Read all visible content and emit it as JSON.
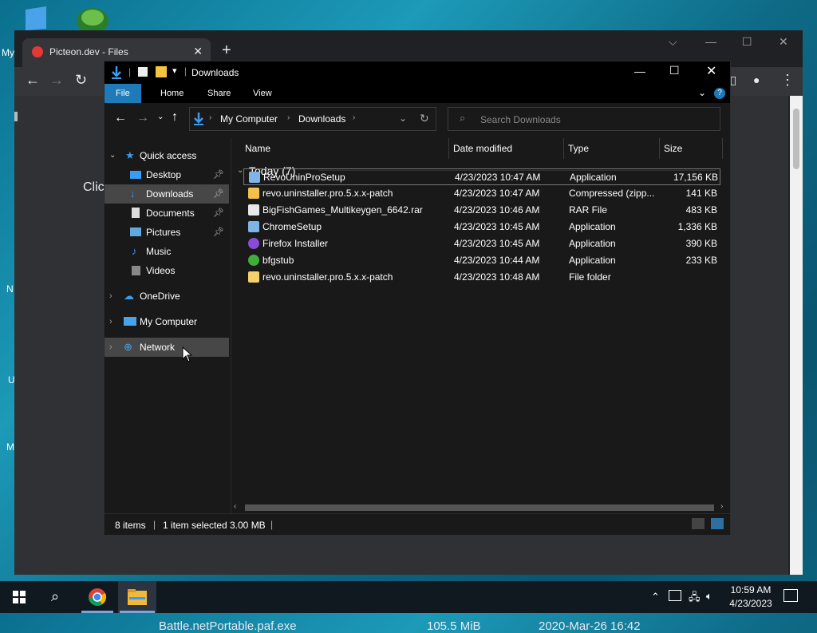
{
  "desktop": {
    "my_label": "My",
    "edge_letters": [
      "N",
      "U",
      "M"
    ]
  },
  "browser": {
    "tab_title": "Picteon.dev - Files",
    "tab_close": "✕",
    "new_tab": "+",
    "page_left_text": "Clic",
    "file_row": {
      "name": "Battle.netPortable.paf.exe",
      "size": "105.5 MiB",
      "date": "2020-Mar-26 16:42"
    }
  },
  "explorer": {
    "title": "Downloads",
    "ribbon_tabs": [
      "File",
      "Home",
      "Share",
      "View"
    ],
    "breadcrumb": [
      "My Computer",
      "Downloads"
    ],
    "search_placeholder": "Search Downloads",
    "nav": {
      "quick_access": "Quick access",
      "desktop": "Desktop",
      "downloads": "Downloads",
      "documents": "Documents",
      "pictures": "Pictures",
      "music": "Music",
      "videos": "Videos",
      "onedrive": "OneDrive",
      "my_computer": "My Computer",
      "network": "Network"
    },
    "columns": [
      "Name",
      "Date modified",
      "Type",
      "Size"
    ],
    "group_header": "Today (7)",
    "files": [
      {
        "name": "RevoUninProSetup",
        "date": "4/23/2023 10:47 AM",
        "type": "Application",
        "size": "17,156 KB",
        "icon": "installer-icon"
      },
      {
        "name": "revo.uninstaller.pro.5.x.x-patch",
        "date": "4/23/2023 10:47 AM",
        "type": "Compressed (zipp...",
        "size": "141 KB",
        "icon": "zip-icon"
      },
      {
        "name": "BigFishGames_Multikeygen_6642.rar",
        "date": "4/23/2023 10:46 AM",
        "type": "RAR File",
        "size": "483 KB",
        "icon": "file-icon"
      },
      {
        "name": "ChromeSetup",
        "date": "4/23/2023 10:45 AM",
        "type": "Application",
        "size": "1,336 KB",
        "icon": "installer-icon"
      },
      {
        "name": "Firefox Installer",
        "date": "4/23/2023 10:45 AM",
        "type": "Application",
        "size": "390 KB",
        "icon": "firefox-icon"
      },
      {
        "name": "bfgstub",
        "date": "4/23/2023 10:44 AM",
        "type": "Application",
        "size": "233 KB",
        "icon": "play-icon"
      },
      {
        "name": "revo.uninstaller.pro.5.x.x-patch",
        "date": "4/23/2023 10:48 AM",
        "type": "File folder",
        "size": "",
        "icon": "folder-icon"
      }
    ],
    "status": {
      "items": "8 items",
      "selected": "1 item selected",
      "size": "3.00 MB"
    }
  },
  "taskbar": {
    "time": "10:59 AM",
    "date": "4/23/2023"
  }
}
